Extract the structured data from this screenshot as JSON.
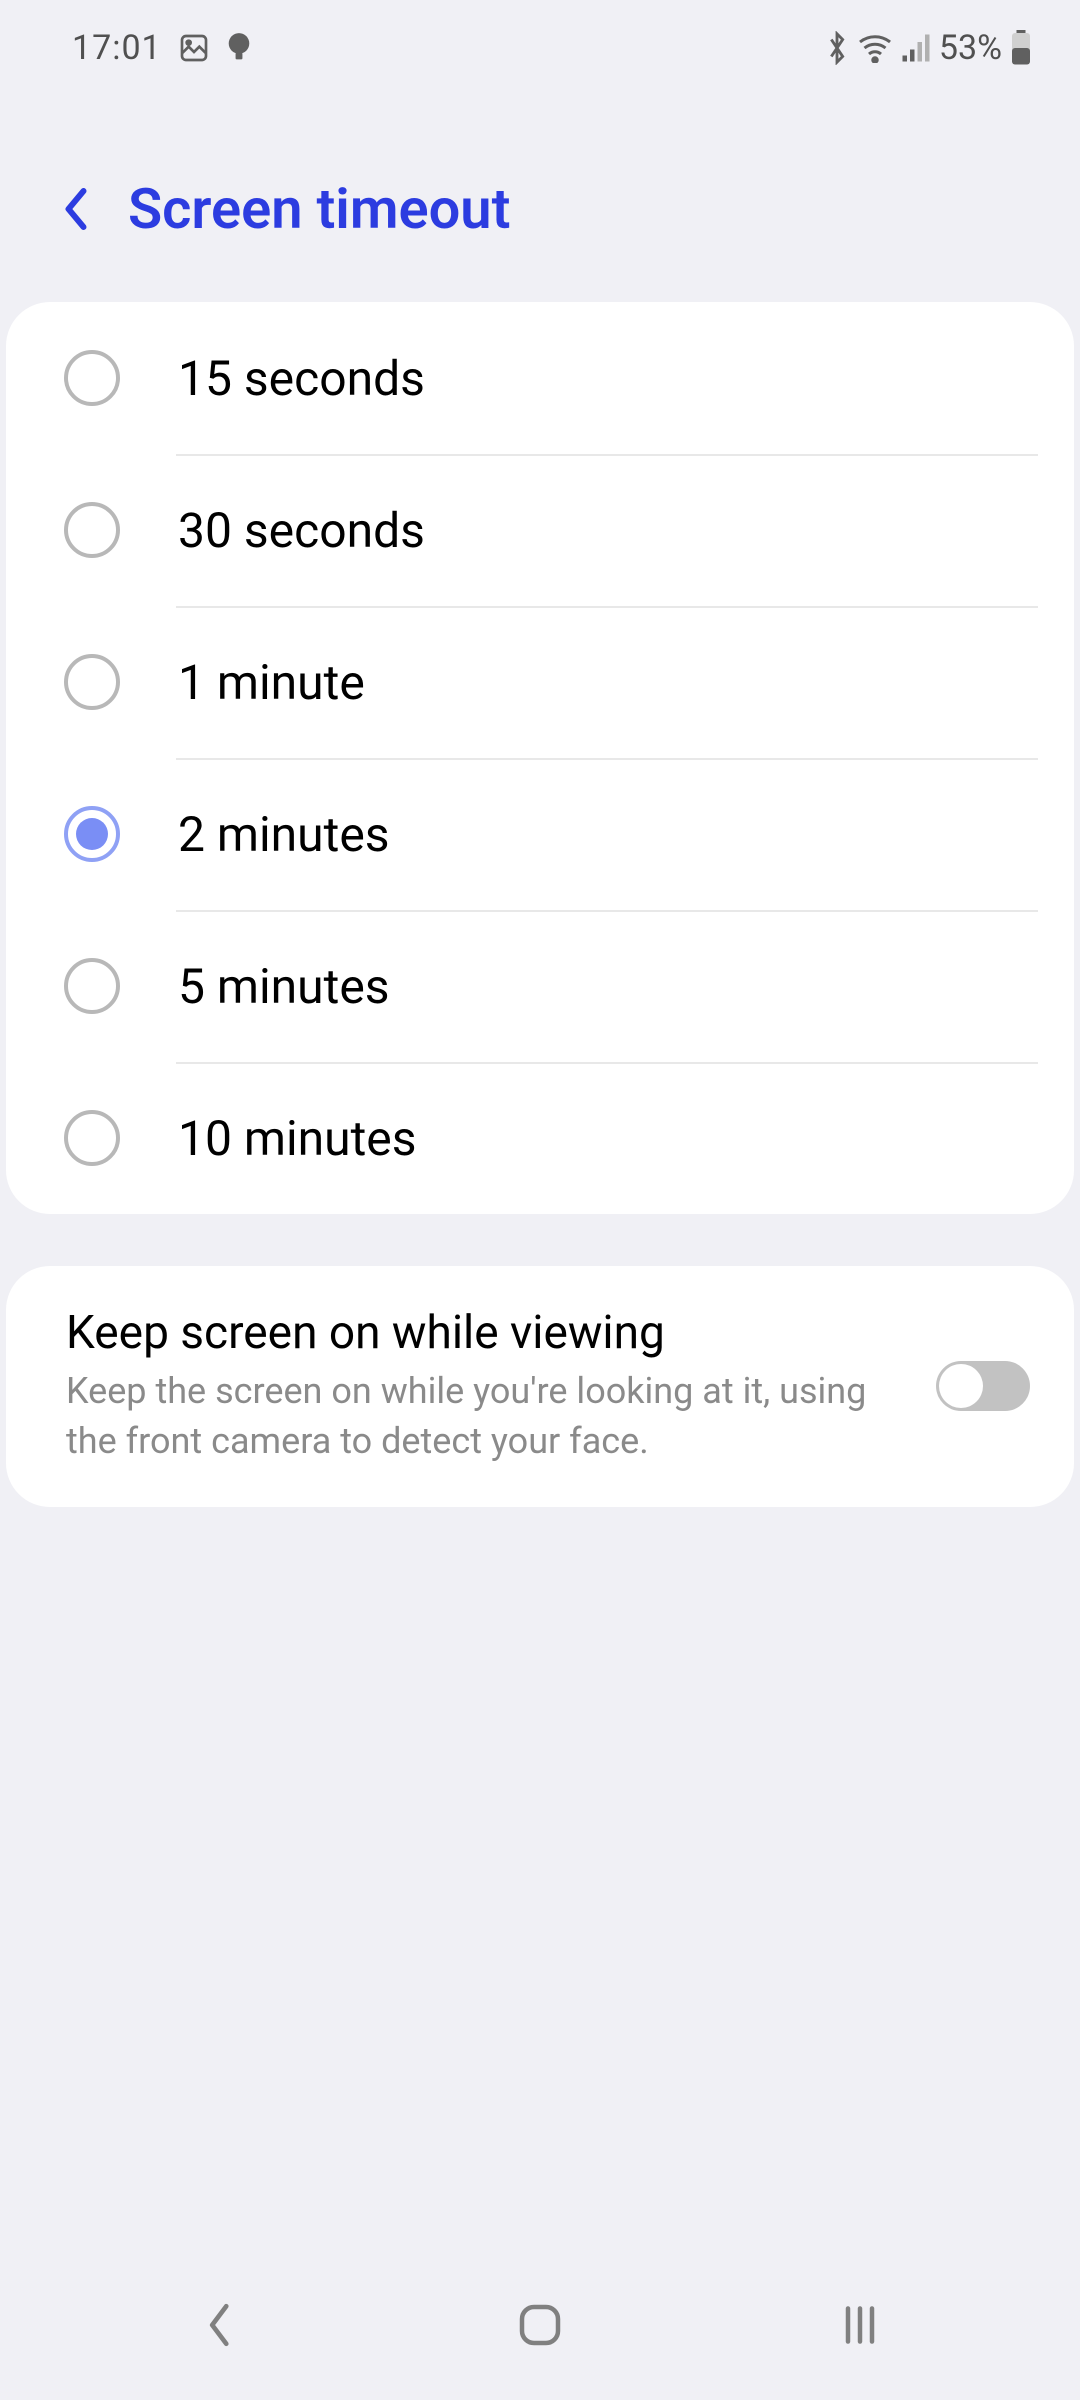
{
  "status": {
    "time": "17:01",
    "battery_pct": "53%"
  },
  "header": {
    "title": "Screen timeout"
  },
  "timeout_options": [
    {
      "label": "15 seconds",
      "selected": false
    },
    {
      "label": "30 seconds",
      "selected": false
    },
    {
      "label": "1 minute",
      "selected": false
    },
    {
      "label": "2 minutes",
      "selected": true
    },
    {
      "label": "5 minutes",
      "selected": false
    },
    {
      "label": "10 minutes",
      "selected": false
    }
  ],
  "keep_screen": {
    "title": "Keep screen on while viewing",
    "desc": "Keep the screen on while you're looking at it, using the front camera to detect your face.",
    "enabled": false
  }
}
